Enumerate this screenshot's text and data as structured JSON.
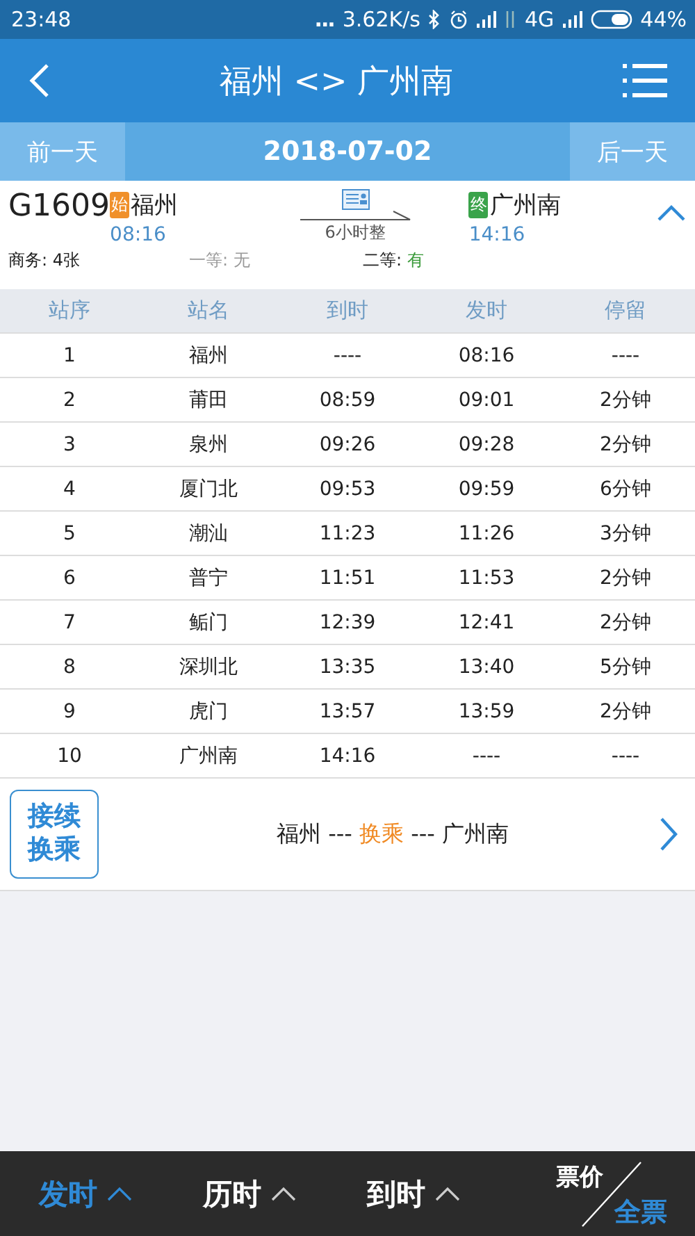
{
  "status_bar": {
    "time": "23:48",
    "dots": "...",
    "speed": "3.62K/s",
    "network": "4G",
    "battery": "44%"
  },
  "header": {
    "title": "福州 <> 广州南"
  },
  "date_bar": {
    "prev": "前一天",
    "date": "2018-07-02",
    "next": "后一天"
  },
  "train": {
    "number": "G1609",
    "from_tag": "始",
    "from": "福州",
    "depart": "08:16",
    "duration": "6小时整",
    "to_tag": "终",
    "to": "广州南",
    "arrive": "14:16",
    "expanded": true,
    "seats": [
      {
        "label": "商务:",
        "value": "4张",
        "kind": "count"
      },
      {
        "label": "一等:",
        "value": "无",
        "kind": "none"
      },
      {
        "label": "二等:",
        "value": "有",
        "kind": "yes"
      }
    ]
  },
  "table": {
    "columns": [
      "站序",
      "站名",
      "到时",
      "发时",
      "停留"
    ],
    "rows": [
      [
        "1",
        "福州",
        "----",
        "08:16",
        "----"
      ],
      [
        "2",
        "莆田",
        "08:59",
        "09:01",
        "2分钟"
      ],
      [
        "3",
        "泉州",
        "09:26",
        "09:28",
        "2分钟"
      ],
      [
        "4",
        "厦门北",
        "09:53",
        "09:59",
        "6分钟"
      ],
      [
        "5",
        "潮汕",
        "11:23",
        "11:26",
        "3分钟"
      ],
      [
        "6",
        "普宁",
        "11:51",
        "11:53",
        "2分钟"
      ],
      [
        "7",
        "鲘门",
        "12:39",
        "12:41",
        "2分钟"
      ],
      [
        "8",
        "深圳北",
        "13:35",
        "13:40",
        "5分钟"
      ],
      [
        "9",
        "虎门",
        "13:57",
        "13:59",
        "2分钟"
      ],
      [
        "10",
        "广州南",
        "14:16",
        "----",
        "----"
      ]
    ]
  },
  "transfer": {
    "badge": "接续换乘",
    "route": "福州 --- **换乘** --- 广州南"
  },
  "bottom_bar": {
    "tabs": [
      {
        "label": "发时",
        "selected": true
      },
      {
        "label": "历时",
        "selected": false
      },
      {
        "label": "到时",
        "selected": false
      }
    ],
    "price_label": "票价",
    "price_value": "全票"
  }
}
